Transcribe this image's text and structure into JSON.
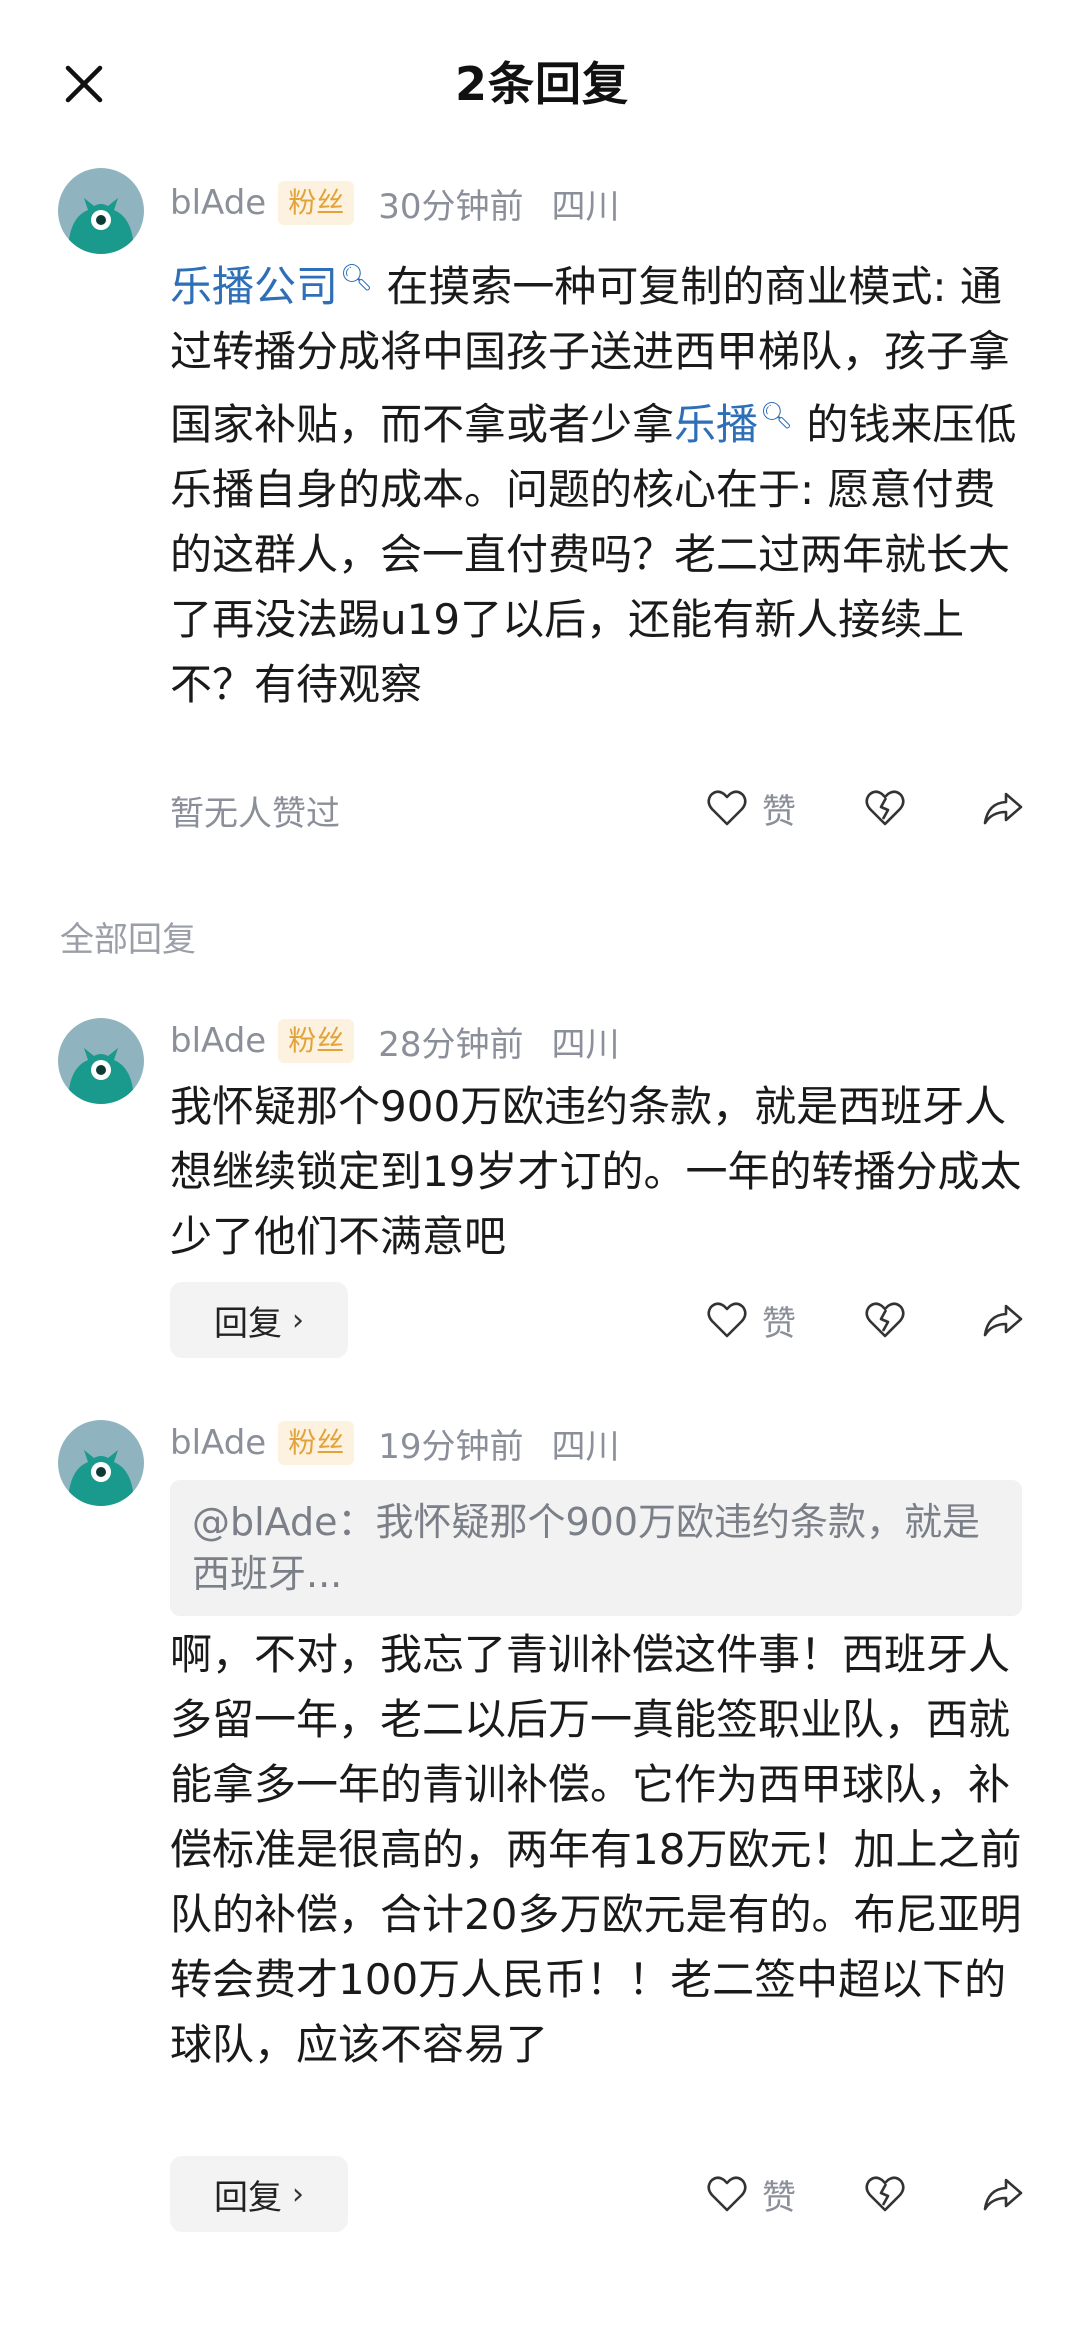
{
  "header": {
    "title": "2条回复"
  },
  "main_comment": {
    "username": "blAde",
    "badge": "粉丝",
    "time": "30分钟前",
    "location": "四川",
    "link1": "乐播公司",
    "text1": " 在摸索一种可复制的商业模式: 通过转播分成将中国孩子送进西甲梯队，孩子拿国家补贴，而不拿或者少拿",
    "link2": "乐播",
    "text2": " 的钱来压低乐播自身的成本。问题的核心在于: 愿意付费的这群人，会一直付费吗？老二过两年就长大了再没法踢u19了以后，还能有新人接续上不？有待观察",
    "likes_text": "暂无人赞过",
    "like_label": "赞"
  },
  "section": {
    "label": "全部回复"
  },
  "replies": [
    {
      "username": "blAde",
      "badge": "粉丝",
      "time": "28分钟前",
      "location": "四川",
      "text": "我怀疑那个900万欧违约条款，就是西班牙人想继续锁定到19岁才订的。一年的转播分成太少了他们不满意吧",
      "reply_label": "回复",
      "like_label": "赞"
    },
    {
      "username": "blAde",
      "badge": "粉丝",
      "time": "19分钟前",
      "location": "四川",
      "quote": "@blAde：我怀疑那个900万欧违约条款，就是西班牙...",
      "text": "啊，不对，我忘了青训补偿这件事！西班牙人多留一年，老二以后万一真能签职业队，西就能拿多一年的青训补偿。它作为西甲球队，补偿标准是很高的，两年有18万欧元！加上之前队的补偿，合计20多万欧元是有的。布尼亚明转会费才100万人民币！！老二签中超以下的球队，应该不容易了",
      "reply_label": "回复",
      "like_label": "赞"
    }
  ],
  "icons": {
    "close": "close-icon",
    "like": "heart-icon",
    "dislike": "broken-heart-icon",
    "share": "share-icon",
    "chevron": "chevron-right-icon"
  },
  "colors": {
    "link": "#2e6fb8",
    "badge_bg": "#fdf2df",
    "badge_text": "#e3a33b",
    "avatar_bg": "#8fb3bf",
    "avatar_creature": "#1a9a8c"
  }
}
